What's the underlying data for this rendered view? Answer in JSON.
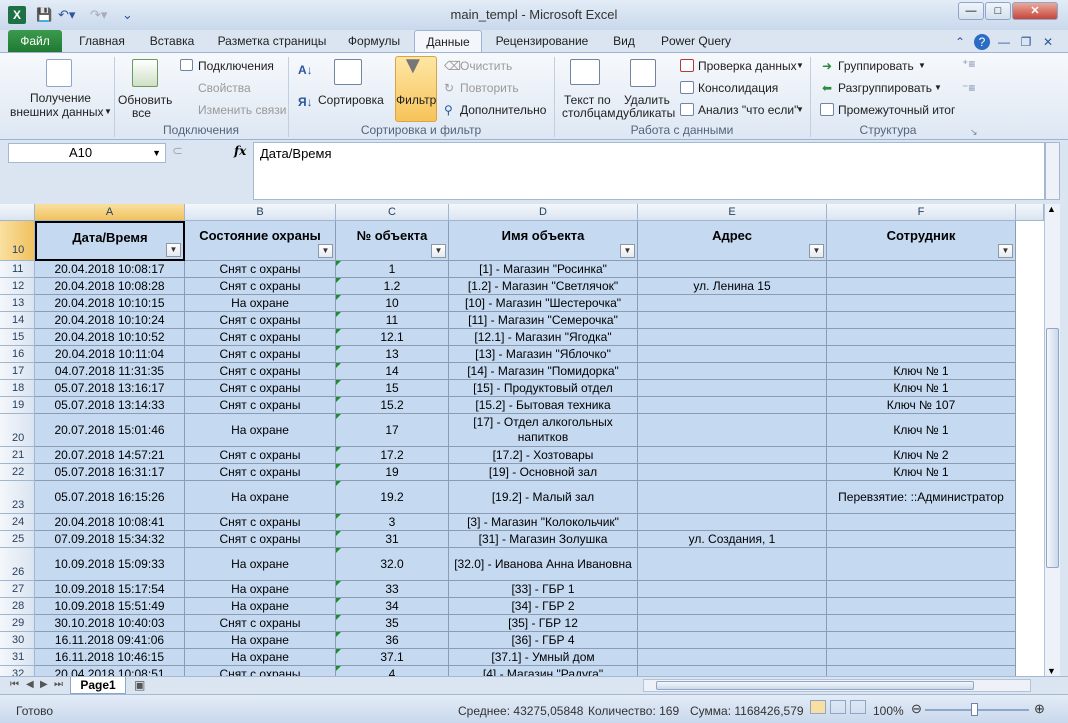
{
  "title_bar": {
    "title": "main_templ - Microsoft Excel",
    "app_icon": "X"
  },
  "window_controls": {
    "minimize": "—",
    "maximize": "□",
    "close": "✕"
  },
  "ribbon_tabs": [
    "Файл",
    "Главная",
    "Вставка",
    "Разметка страницы",
    "Формулы",
    "Данные",
    "Рецензирование",
    "Вид",
    "Power Query"
  ],
  "active_tab": "Данные",
  "ribbon": {
    "get_external": "Получение\nвнешних данных",
    "get_external_l1": "Получение",
    "get_external_l2": "внешних данных",
    "refresh_l1": "Обновить",
    "refresh_l2": "все",
    "connections": "Подключения",
    "properties": "Свойства",
    "edit_links": "Изменить связи",
    "group_connections": "Подключения",
    "sort": "Сортировка",
    "filter": "Фильтр",
    "clear": "Очистить",
    "reapply": "Повторить",
    "advanced": "Дополнительно",
    "group_sort_filter": "Сортировка и фильтр",
    "text_to_cols_l1": "Текст по",
    "text_to_cols_l2": "столбцам",
    "remove_dups_l1": "Удалить",
    "remove_dups_l2": "дубликаты",
    "validation": "Проверка данных",
    "consolidate": "Консолидация",
    "whatif": "Анализ \"что если\"",
    "group_data_tools": "Работа с данными",
    "group": "Группировать",
    "ungroup": "Разгруппировать",
    "subtotal": "Промежуточный итог",
    "group_outline": "Структура"
  },
  "formula_bar": {
    "name_box": "A10",
    "fx": "fx",
    "formula": "Дата/Время"
  },
  "columns": [
    "A",
    "B",
    "C",
    "D",
    "E",
    "F"
  ],
  "headers": [
    "Дата/Время",
    "Состояние охраны",
    "№ объекта",
    "Имя объекта",
    "Адрес",
    "Сотрудник"
  ],
  "header_row_num": "10",
  "rows": [
    {
      "n": "11",
      "a": "20.04.2018 10:08:17",
      "b": "Снят с охраны",
      "c": "1",
      "d": "[1] - Магазин \"Росинка\"",
      "e": "",
      "f": ""
    },
    {
      "n": "12",
      "a": "20.04.2018 10:08:28",
      "b": "Снят с охраны",
      "c": "1.2",
      "d": "[1.2] - Магазин \"Светлячок\"",
      "e": "ул. Ленина 15",
      "f": ""
    },
    {
      "n": "13",
      "a": "20.04.2018 10:10:15",
      "b": "На охране",
      "c": "10",
      "d": "[10] - Магазин \"Шестерочка\"",
      "e": "",
      "f": ""
    },
    {
      "n": "14",
      "a": "20.04.2018 10:10:24",
      "b": "Снят с охраны",
      "c": "11",
      "d": "[11] - Магазин \"Семерочка\"",
      "e": "",
      "f": ""
    },
    {
      "n": "15",
      "a": "20.04.2018 10:10:52",
      "b": "Снят с охраны",
      "c": "12.1",
      "d": "[12.1] - Магазин \"Ягодка\"",
      "e": "",
      "f": ""
    },
    {
      "n": "16",
      "a": "20.04.2018 10:11:04",
      "b": "Снят с охраны",
      "c": "13",
      "d": "[13] - Магазин \"Яблочко\"",
      "e": "",
      "f": ""
    },
    {
      "n": "17",
      "a": "04.07.2018 11:31:35",
      "b": "Снят с охраны",
      "c": "14",
      "d": "[14] - Магазин \"Помидорка\"",
      "e": "",
      "f": "Ключ № 1"
    },
    {
      "n": "18",
      "a": "05.07.2018 13:16:17",
      "b": "Снят с охраны",
      "c": "15",
      "d": "[15] - Продуктовый отдел",
      "e": "",
      "f": "Ключ № 1"
    },
    {
      "n": "19",
      "a": "05.07.2018 13:14:33",
      "b": "Снят с охраны",
      "c": "15.2",
      "d": "[15.2] - Бытовая техника",
      "e": "",
      "f": "Ключ № 107"
    },
    {
      "n": "20",
      "a": "20.07.2018 15:01:46",
      "b": "На охране",
      "c": "17",
      "d": "[17] - Отдел алкогольных напитков",
      "e": "",
      "f": "Ключ № 1"
    },
    {
      "n": "21",
      "a": "20.07.2018 14:57:21",
      "b": "Снят с охраны",
      "c": "17.2",
      "d": "[17.2] - Хозтовары",
      "e": "",
      "f": "Ключ № 2"
    },
    {
      "n": "22",
      "a": "05.07.2018 16:31:17",
      "b": "Снят с охраны",
      "c": "19",
      "d": "[19] - Основной зал",
      "e": "",
      "f": "Ключ № 1"
    },
    {
      "n": "23",
      "a": "05.07.2018 16:15:26",
      "b": "На охране",
      "c": "19.2",
      "d": "[19.2] - Малый зал",
      "e": "",
      "f": "Перевзятие: ::Администратор"
    },
    {
      "n": "24",
      "a": "20.04.2018 10:08:41",
      "b": "Снят с охраны",
      "c": "3",
      "d": "[3] - Магазин \"Колокольчик\"",
      "e": "",
      "f": ""
    },
    {
      "n": "25",
      "a": "07.09.2018 15:34:32",
      "b": "Снят с охраны",
      "c": "31",
      "d": "[31] - Магазин Золушка",
      "e": "ул. Создания, 1",
      "f": ""
    },
    {
      "n": "26",
      "a": "10.09.2018 15:09:33",
      "b": "На охране",
      "c": "32.0",
      "d": "[32.0] - Иванова Анна Ивановна",
      "e": "",
      "f": ""
    },
    {
      "n": "27",
      "a": "10.09.2018 15:17:54",
      "b": "На охране",
      "c": "33",
      "d": "[33] - ГБР 1",
      "e": "",
      "f": ""
    },
    {
      "n": "28",
      "a": "10.09.2018 15:51:49",
      "b": "На охране",
      "c": "34",
      "d": "[34] - ГБР 2",
      "e": "",
      "f": ""
    },
    {
      "n": "29",
      "a": "30.10.2018 10:40:03",
      "b": "Снят с охраны",
      "c": "35",
      "d": "[35] - ГБР 12",
      "e": "",
      "f": ""
    },
    {
      "n": "30",
      "a": "16.11.2018 09:41:06",
      "b": "На охране",
      "c": "36",
      "d": "[36] - ГБР 4",
      "e": "",
      "f": ""
    },
    {
      "n": "31",
      "a": "16.11.2018 10:46:15",
      "b": "На охране",
      "c": "37.1",
      "d": "[37.1] - Умный дом",
      "e": "",
      "f": ""
    },
    {
      "n": "32",
      "a": "20.04.2018 10:08:51",
      "b": "Снят с охраны",
      "c": "4",
      "d": "[4] - Магазин \"Радуга\"",
      "e": "",
      "f": ""
    }
  ],
  "sheet_tab": "Page1",
  "status": {
    "ready": "Готово",
    "average": "Среднее: 43275,05848",
    "count": "Количество: 169",
    "sum": "Сумма: 1168426,579",
    "zoom": "100%"
  },
  "colors": {
    "cell_fill": "#c5d9f1",
    "file_tab": "#1f7a32",
    "selected_header": "#f1c15f"
  }
}
